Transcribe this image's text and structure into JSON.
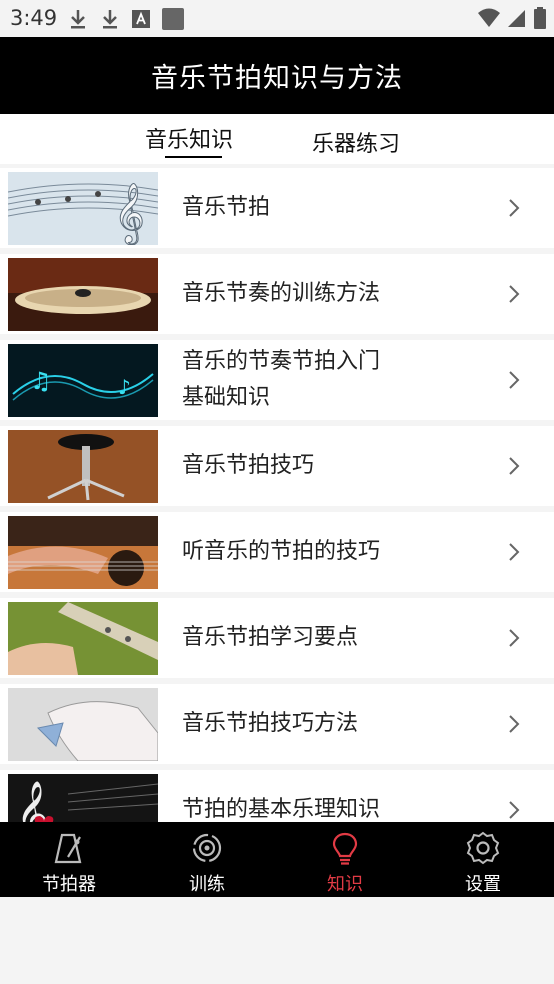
{
  "status_bar": {
    "time": "3:49"
  },
  "header": {
    "title": "音乐节拍知识与方法"
  },
  "tabs": [
    {
      "label": "音乐知识",
      "active": true
    },
    {
      "label": "乐器练习",
      "active": false
    }
  ],
  "items": [
    {
      "title": "音乐节拍"
    },
    {
      "title": "音乐节奏的训练方法"
    },
    {
      "title": "音乐的节奏节拍入门基础知识"
    },
    {
      "title": "音乐节拍技巧"
    },
    {
      "title": "听音乐的节拍的技巧"
    },
    {
      "title": "音乐节拍学习要点"
    },
    {
      "title": "音乐节拍技巧方法"
    },
    {
      "title": "节拍的基本乐理知识"
    }
  ],
  "bottom_nav": [
    {
      "label": "节拍器",
      "icon": "metronome-icon"
    },
    {
      "label": "训练",
      "icon": "training-icon"
    },
    {
      "label": "知识",
      "icon": "lightbulb-icon",
      "active": true
    },
    {
      "label": "设置",
      "icon": "gear-icon"
    }
  ],
  "colors": {
    "header_bg": "#000000",
    "nav_bg": "#000000",
    "active": "#e23b45"
  }
}
